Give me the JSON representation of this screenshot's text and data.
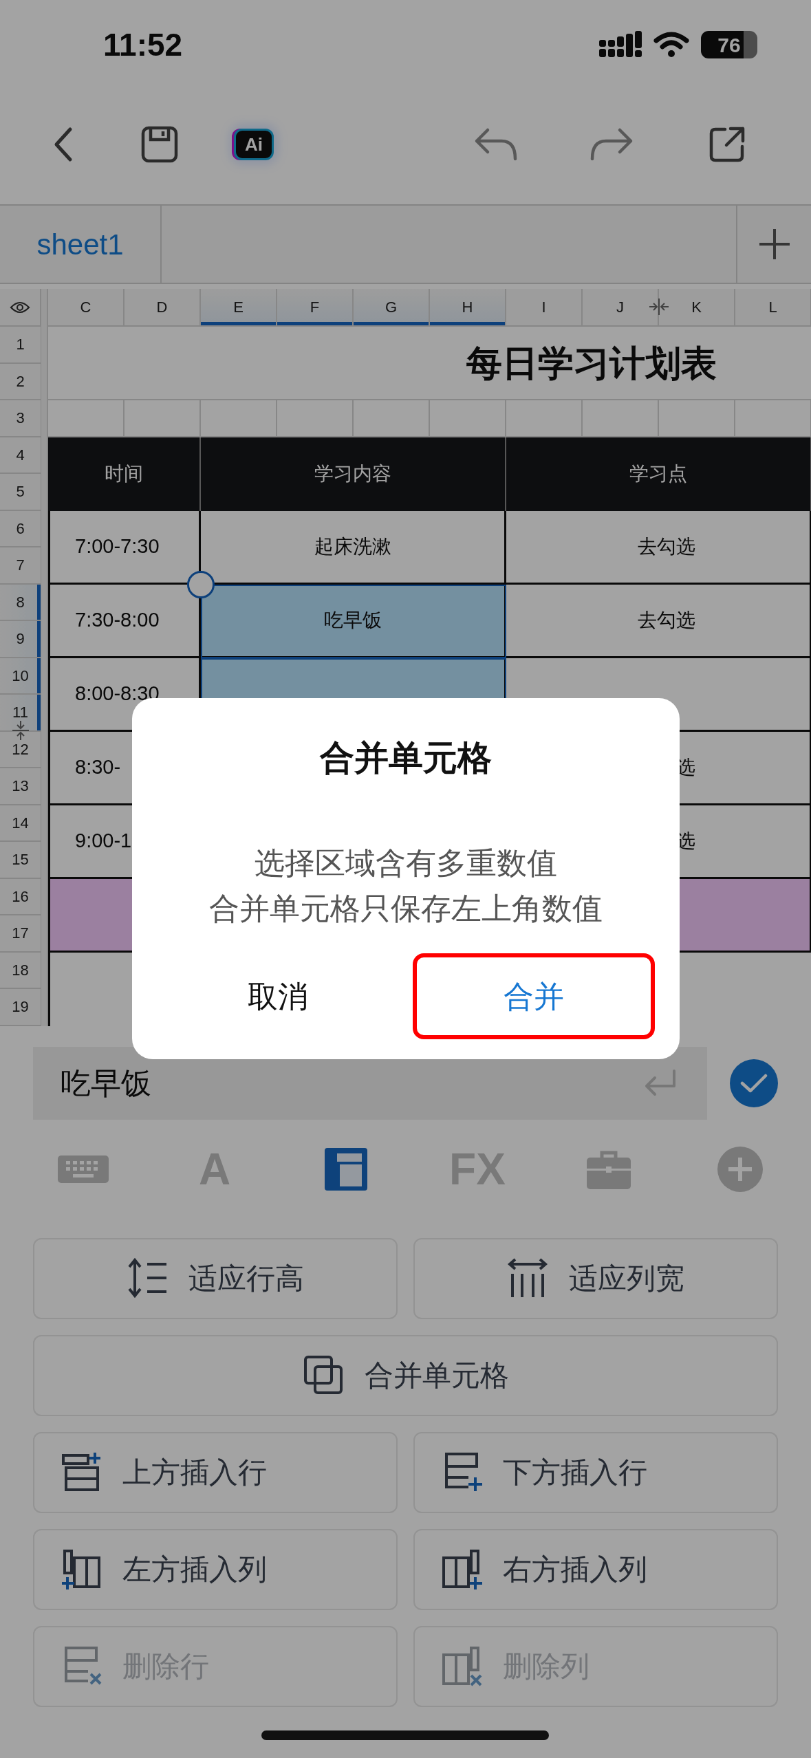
{
  "status_bar": {
    "time": "11:52",
    "battery": "76"
  },
  "toolbar": {
    "ai_label": "Ai",
    "undo": {
      "disabled": true
    },
    "redo": {
      "disabled": true
    }
  },
  "sheet_tabs": [
    {
      "label": "sheet1",
      "selected": true
    }
  ],
  "grid": {
    "columns": [
      {
        "label": "C",
        "selected": false
      },
      {
        "label": "D",
        "selected": false
      },
      {
        "label": "E",
        "selected": true
      },
      {
        "label": "F",
        "selected": true
      },
      {
        "label": "G",
        "selected": true
      },
      {
        "label": "H",
        "selected": true
      },
      {
        "label": "I",
        "selected": false
      },
      {
        "label": "J",
        "selected": false
      },
      {
        "label": "K",
        "selected": false
      },
      {
        "label": "L",
        "selected": false
      }
    ],
    "rows": [
      {
        "label": "1",
        "selected": false
      },
      {
        "label": "2",
        "selected": false
      },
      {
        "label": "3",
        "selected": false
      },
      {
        "label": "4",
        "selected": false
      },
      {
        "label": "5",
        "selected": false
      },
      {
        "label": "6",
        "selected": false
      },
      {
        "label": "7",
        "selected": false
      },
      {
        "label": "8",
        "selected": true
      },
      {
        "label": "9",
        "selected": true
      },
      {
        "label": "10",
        "selected": true
      },
      {
        "label": "11",
        "selected": true
      },
      {
        "label": "12",
        "selected": false
      },
      {
        "label": "13",
        "selected": false
      },
      {
        "label": "14",
        "selected": false
      },
      {
        "label": "15",
        "selected": false
      },
      {
        "label": "16",
        "selected": false
      },
      {
        "label": "17",
        "selected": false
      },
      {
        "label": "18",
        "selected": false
      },
      {
        "label": "19",
        "selected": false
      }
    ]
  },
  "title": "每日学习计划表",
  "header": [
    "时间",
    "学习内容",
    "学习点"
  ],
  "entries": [
    {
      "time": "7:00-7:30",
      "content": "起床洗漱",
      "point": "去勾选",
      "selected": false,
      "highlighted": false
    },
    {
      "time": "7:30-8:00",
      "content": "吃早饭",
      "point": "去勾选",
      "selected": true,
      "highlighted": false
    },
    {
      "time": "8:00-8:30",
      "selected": true,
      "highlighted": false
    },
    {
      "time": "8:30-",
      "point": "选",
      "highlighted": false
    },
    {
      "time": "9:00-1",
      "point": "选",
      "highlighted": false
    },
    {
      "highlighted": true
    }
  ],
  "formula_bar": {
    "value": "吃早饭"
  },
  "panel_tabs": [
    {
      "kind": "keyboard",
      "selected": false
    },
    {
      "kind": "text",
      "label": "A",
      "selected": false
    },
    {
      "kind": "layout",
      "selected": true
    },
    {
      "kind": "text",
      "label": "FX",
      "selected": false
    },
    {
      "kind": "toolbox",
      "selected": false
    },
    {
      "kind": "plus",
      "selected": false
    }
  ],
  "actions": [
    {
      "label": "适应行高",
      "kind": "half",
      "disabled": false
    },
    {
      "label": "适应列宽",
      "kind": "half",
      "disabled": false
    },
    {
      "label": "合并单元格",
      "kind": "wide",
      "disabled": false
    },
    {
      "label": "上方插入行",
      "kind": "half",
      "disabled": false
    },
    {
      "label": "下方插入行",
      "kind": "half",
      "disabled": false
    },
    {
      "label": "左方插入列",
      "kind": "half",
      "disabled": false
    },
    {
      "label": "右方插入列",
      "kind": "half",
      "disabled": false
    },
    {
      "label": "删除行",
      "kind": "half",
      "disabled": true
    },
    {
      "label": "删除列",
      "kind": "half",
      "disabled": true
    }
  ],
  "dialog": {
    "title": "合并单元格",
    "message": [
      "选择区域含有多重数值",
      "合并单元格只保存左上角数值"
    ],
    "buttons": [
      {
        "label": "取消",
        "kind": "cancel",
        "highlighted": false
      },
      {
        "label": "合并",
        "kind": "confirm",
        "highlighted": true
      }
    ]
  }
}
